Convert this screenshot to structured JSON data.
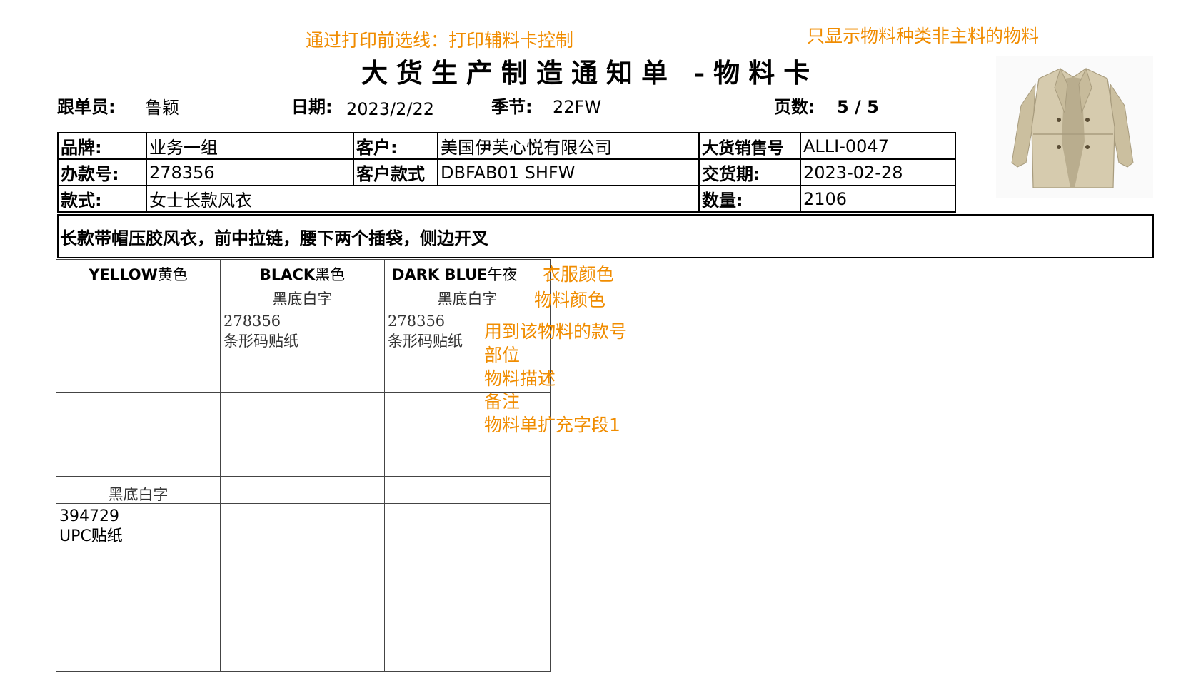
{
  "annotations": {
    "print_control": "通过打印前选线：打印辅料卡控制",
    "material_filter": "只显示物料种类非主料的物料",
    "garment_color": "衣服颜色",
    "material_color": "物料颜色",
    "style_no_using": "用到该物料的款号",
    "part": "部位",
    "material_desc": "物料描述",
    "remark": "备注",
    "ext_field": "物料单扩充字段1"
  },
  "title": "大货生产制造通知单 -物料卡",
  "header": {
    "merchandiser_label": "跟单员:",
    "merchandiser_value": "鲁颖",
    "date_label": "日期:",
    "date_value": "2023/2/22",
    "season_label": "季节:",
    "season_value": "22FW",
    "page_label": "页数:",
    "page_value": "5 / 5"
  },
  "info": {
    "brand_label": "品牌:",
    "brand_value": "业务一组",
    "customer_label": "客户:",
    "customer_value": "美国伊芙心悦有限公司",
    "bulk_sales_label": "大货销售号",
    "bulk_sales_value": "ALLI-0047",
    "sample_no_label": "办款号:",
    "sample_no_value": "278356",
    "customer_style_label": "客户款式",
    "customer_style_value": "DBFAB01 SHFW",
    "delivery_label": "交货期:",
    "delivery_value": "2023-02-28",
    "style_label": "款式:",
    "style_value": "女士长款风衣",
    "quantity_label": "数量:",
    "quantity_value": "2106"
  },
  "description": "长款带帽压胶风衣，前中拉链，腰下两个插袋，侧边开叉",
  "colors": [
    {
      "en": "YELLOW",
      "cn": "黄色"
    },
    {
      "en": "BLACK",
      "cn": "黑色"
    },
    {
      "en": "DARK BLUE",
      "cn": "午夜"
    }
  ],
  "rows": {
    "r1_colors": [
      "",
      "黑底白字",
      "黑底白字"
    ],
    "r1_materials": [
      {
        "code": "",
        "name": ""
      },
      {
        "code": "278356",
        "name": "条形码贴纸"
      },
      {
        "code": "278356",
        "name": "条形码贴纸"
      }
    ],
    "r2_colors": [
      "黑底白字",
      "",
      ""
    ],
    "r2_materials": [
      {
        "code": "394729",
        "name": "UPC贴纸"
      },
      {
        "code": "",
        "name": ""
      },
      {
        "code": "",
        "name": ""
      }
    ]
  },
  "image": {
    "name": "coat-photo",
    "color": "#cfc3a5"
  }
}
